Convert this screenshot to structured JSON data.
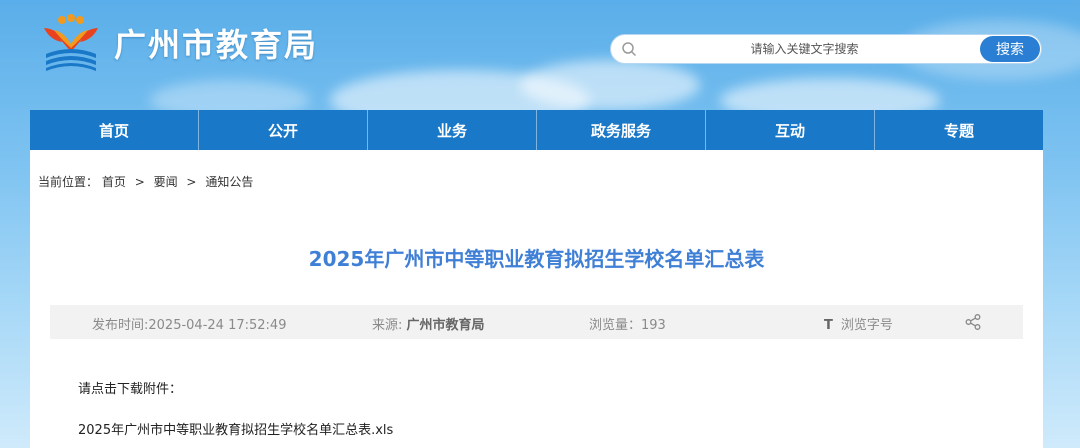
{
  "site": {
    "title": "广州市教育局"
  },
  "search": {
    "placeholder": "请输入关键文字搜索",
    "button_label": "搜索"
  },
  "nav": {
    "items": [
      "首页",
      "公开",
      "业务",
      "政务服务",
      "互动",
      "专题"
    ]
  },
  "breadcrumb": {
    "prefix": "当前位置：",
    "items": [
      "首页",
      "要闻",
      "通知公告"
    ],
    "separator": ">"
  },
  "article": {
    "title": "2025年广州市中等职业教育拟招生学校名单汇总表",
    "publish_label": "发布时间:",
    "publish_time": "2025-04-24 17:52:49",
    "source_label": "来源:",
    "source": "广州市教育局",
    "views_label": "浏览量：",
    "views": "193",
    "font_size_glyph": "T",
    "font_size_label": "浏览字号",
    "attachment_prompt": "请点击下载附件：",
    "attachment_file": "2025年广州市中等职业教育拟招生学校名单汇总表.xls"
  },
  "colors": {
    "nav_bg": "#1a78c8",
    "title_blue": "#3f7fd6",
    "search_button": "#2a7fd5",
    "meta_bg": "#f2f2f2"
  }
}
